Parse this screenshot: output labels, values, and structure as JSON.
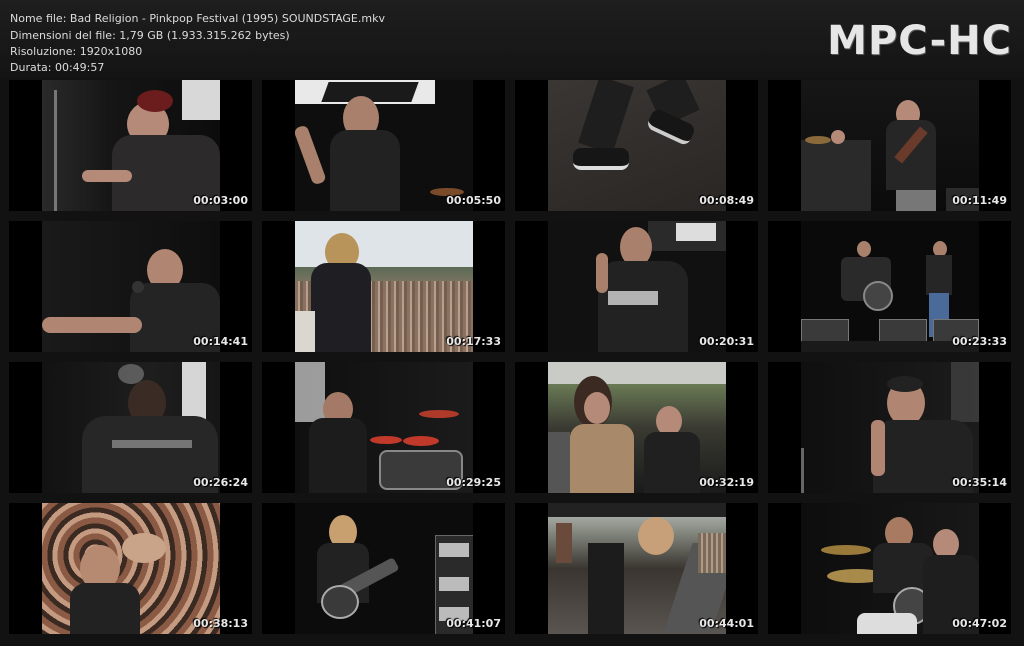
{
  "header": {
    "file_name": "Nome file: Bad Religion - Pinkpop Festival (1995) SOUNDSTAGE.mkv",
    "file_size": "Dimensioni del file: 1,79 GB (1.933.315.262 bytes)",
    "resolution": "Risoluzione: 1920x1080",
    "duration": "Durata: 00:49:57",
    "logo": "MPC-HC"
  },
  "thumbnails": [
    {
      "time": "00:03:00",
      "scene": "singer-stage-left"
    },
    {
      "time": "00:05:50",
      "scene": "singer-mic-banner"
    },
    {
      "time": "00:08:49",
      "scene": "feet-stage-floor"
    },
    {
      "time": "00:11:49",
      "scene": "band-wide-guitar"
    },
    {
      "time": "00:14:41",
      "scene": "singer-pointing"
    },
    {
      "time": "00:17:33",
      "scene": "crowd-from-stage"
    },
    {
      "time": "00:20:31",
      "scene": "singer-shirt"
    },
    {
      "time": "00:23:33",
      "scene": "stage-wide-drums"
    },
    {
      "time": "00:26:24",
      "scene": "singer-back"
    },
    {
      "time": "00:29:25",
      "scene": "drummer-kit"
    },
    {
      "time": "00:32:19",
      "scene": "two-singers-daylight"
    },
    {
      "time": "00:35:14",
      "scene": "singer-closeup"
    },
    {
      "time": "00:38:13",
      "scene": "crowd-closeup"
    },
    {
      "time": "00:41:07",
      "scene": "guitarist-amps"
    },
    {
      "time": "00:44:01",
      "scene": "guitarist-stage-edge"
    },
    {
      "time": "00:47:02",
      "scene": "singer-drummer-kit"
    }
  ]
}
